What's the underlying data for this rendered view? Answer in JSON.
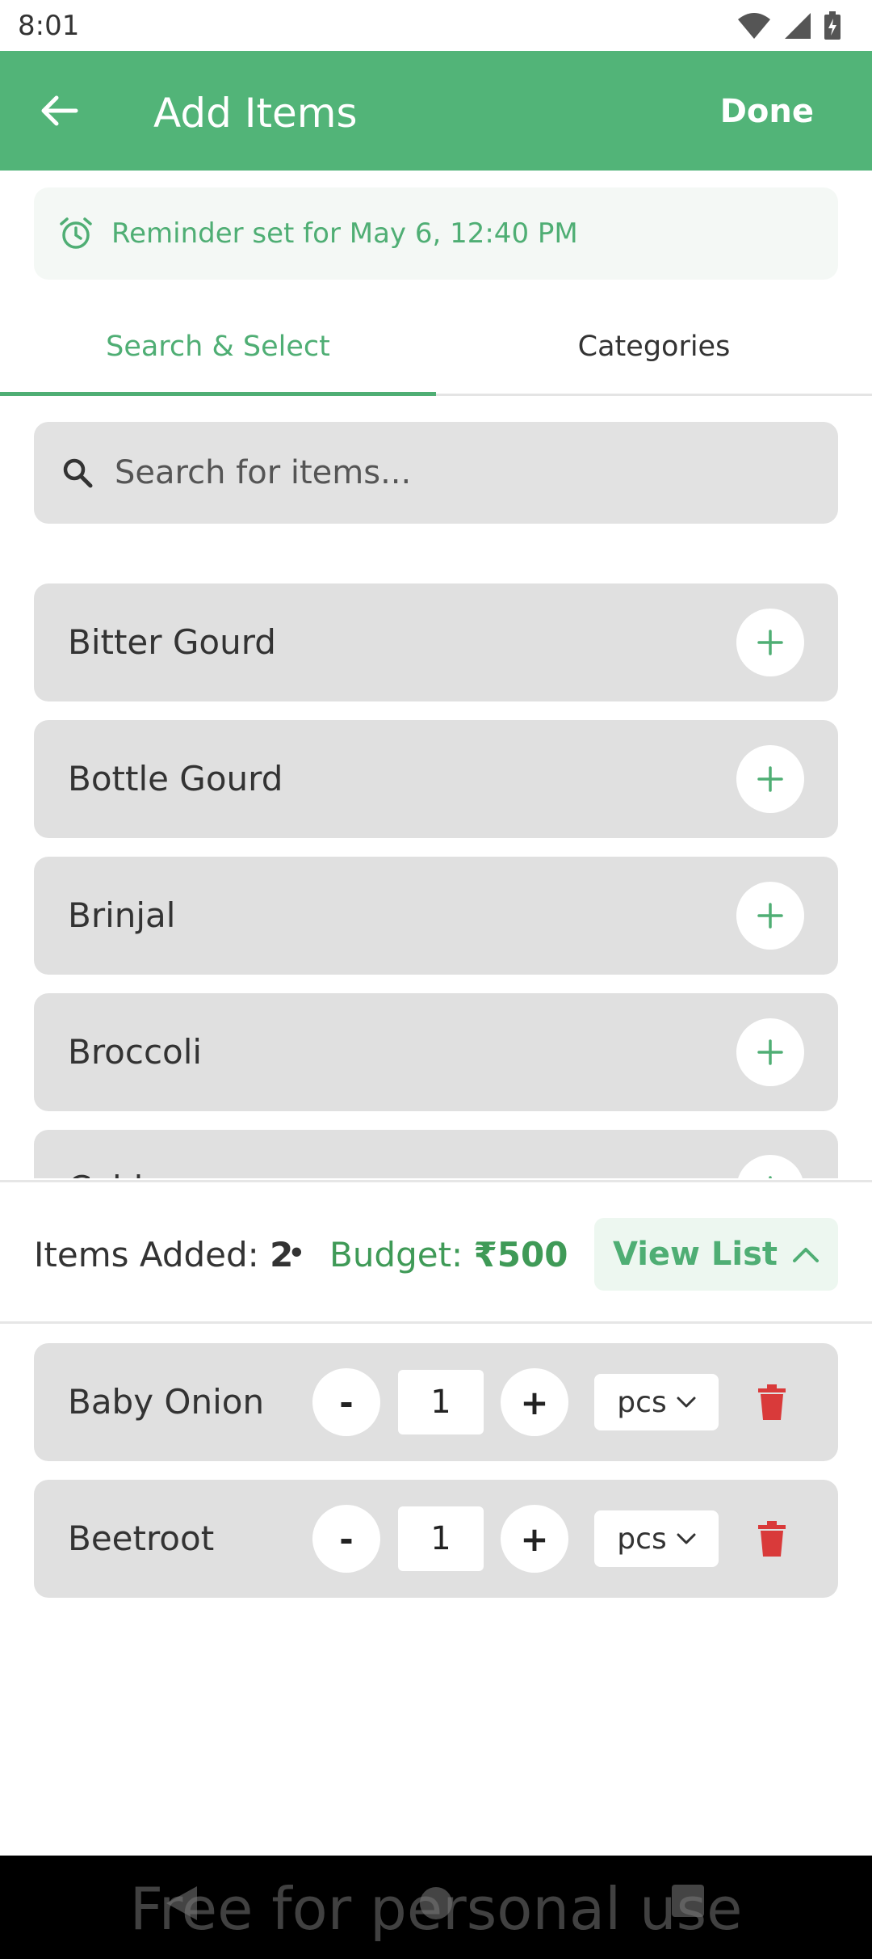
{
  "status_bar": {
    "time": "8:01"
  },
  "app_bar": {
    "title": "Add Items",
    "done_label": "Done"
  },
  "reminder": {
    "text": "Reminder set for May 6, 12:40 PM"
  },
  "tabs": [
    {
      "label": "Search & Select",
      "active": true
    },
    {
      "label": "Categories",
      "active": false
    }
  ],
  "search": {
    "placeholder": "Search for items..."
  },
  "items": [
    {
      "name": "Bitter Gourd"
    },
    {
      "name": "Bottle Gourd"
    },
    {
      "name": "Brinjal"
    },
    {
      "name": "Broccoli"
    },
    {
      "name": "Cabbage"
    }
  ],
  "summary": {
    "items_added_label": "Items Added:",
    "items_added_count": "2",
    "separator": "•",
    "budget_label": "Budget:",
    "budget_value": "₹500",
    "view_list_label": "View List"
  },
  "selected_items": [
    {
      "name": "Baby Onion",
      "quantity": "1",
      "unit": "pcs",
      "minus": "-",
      "plus": "+"
    },
    {
      "name": "Beetroot",
      "quantity": "1",
      "unit": "pcs",
      "minus": "-",
      "plus": "+"
    }
  ],
  "watermark": "Free for personal use",
  "colors": {
    "primary": "#52b478",
    "accent_text": "#4fae74",
    "budget": "#3f9a57",
    "delete": "#d93a3a",
    "card": "#e0e0e0"
  }
}
